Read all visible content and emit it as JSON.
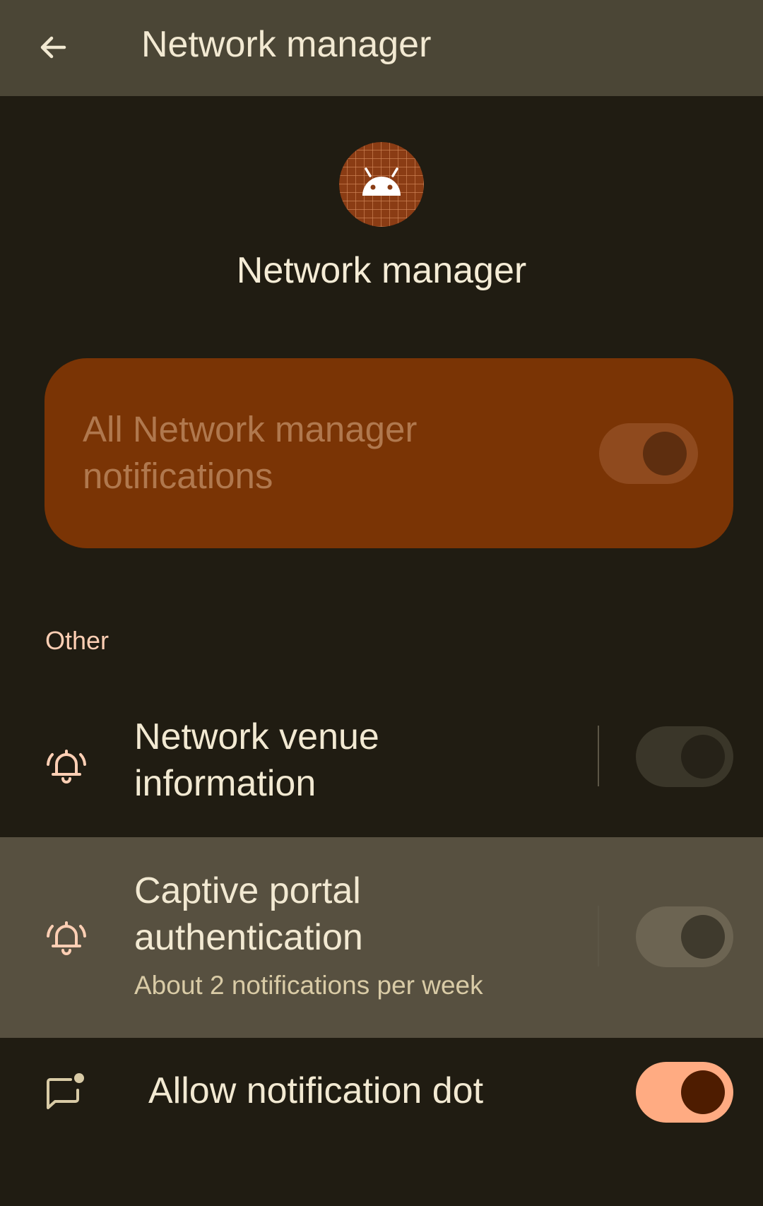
{
  "topbar": {
    "title": "Network manager"
  },
  "app": {
    "name": "Network manager"
  },
  "all_notifications": {
    "label": "All Network manager notifications",
    "enabled": true
  },
  "section": {
    "header": "Other"
  },
  "channels": [
    {
      "title": "Network venue information",
      "subtitle": "",
      "enabled": false
    },
    {
      "title": "Captive portal authentication",
      "subtitle": "About 2 notifications per week",
      "enabled": false
    }
  ],
  "notification_dot": {
    "label": "Allow notification dot",
    "enabled": true
  },
  "colors": {
    "background": "#201c12",
    "topbar": "#4b4636",
    "card": "#7a3405",
    "accent": "#ffab82",
    "highlight_row": "#575040"
  },
  "icons": {
    "back": "arrow-back-icon",
    "app": "android-icon",
    "channel": "bell-ring-icon",
    "dot": "notification-dot-icon"
  }
}
